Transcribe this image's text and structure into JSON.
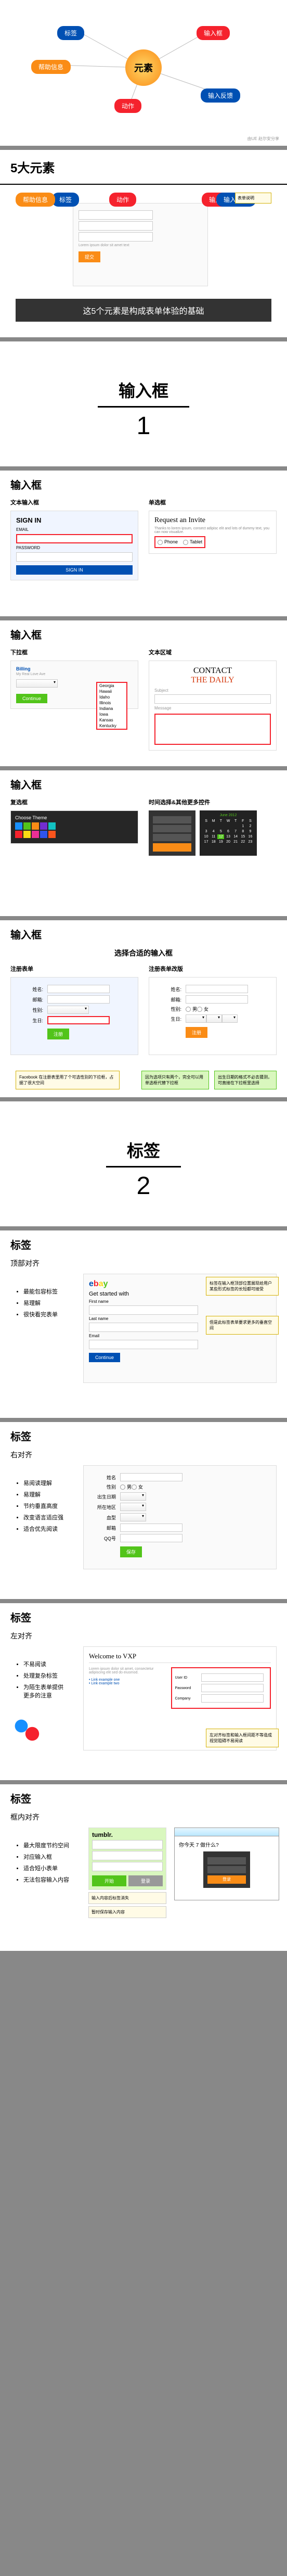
{
  "slide1": {
    "center": "元素",
    "nodes": {
      "tl": "标签",
      "tr": "输入框",
      "l": "帮助信息",
      "br": "输入反馈",
      "b": "动作"
    },
    "foot": "由UE 赵尔安分享"
  },
  "slide2": {
    "title": "5大元素",
    "banner": "这5个元素是构成表单体验的基础",
    "nodes": {
      "标签": "标签",
      "帮助信息": "帮助信息",
      "输入框": "输入框",
      "输入反馈": "输入反馈",
      "动作": "动作"
    }
  },
  "slide3": {
    "title": "输入框",
    "num": "1"
  },
  "slide4": {
    "title": "输入框",
    "left": "文本输入框",
    "right": "单选框",
    "signin": "SIGN IN",
    "req": "Request an Invite",
    "req_sub": "Thanks to lorem ipsum, consect adipisc elit and lots of dummy text, you can now visualize.",
    "radio1": "Phone",
    "radio2": "Tablet"
  },
  "slide5": {
    "title": "输入框",
    "left": "下拉框",
    "right": "文本区域",
    "billing": "Billing",
    "contact1": "CONTACT",
    "contact2": "THE DAILY",
    "subj": "Subject",
    "msg": "Message"
  },
  "slide6": {
    "title": "输入框",
    "left": "复选框",
    "right": "时间选择&其他更多控件",
    "cal": "June 2012"
  },
  "slide7": {
    "title": "输入框",
    "sub": "选择合适的输入框",
    "left": "注册表单",
    "right": "注册表单改版",
    "note1": "Facebook 在注册表里用了个可选性别的下拉框，占据了很大空间",
    "note2": "因为选项只有两个，完全可以用单选框代替下拉框",
    "note3": "出生日期的格式不必去猜测，可直接在下拉框里选择"
  },
  "slide8": {
    "title": "标签",
    "num": "2"
  },
  "slide9": {
    "title": "标签",
    "sub": "顶部对齐",
    "items": [
      "最能包容标签",
      "易理解",
      "很快看完表单"
    ],
    "ebay_label": "Get started with"
  },
  "slide10": {
    "title": "标签",
    "sub": "右对齐",
    "items": [
      "易阅读理解",
      "易理解",
      "节约垂直高度",
      "改变语言适应强",
      "适合优先阅读"
    ],
    "lbl_name": "姓名",
    "lbl_gender": "性别",
    "lbl_birth": "出生日期",
    "lbl_area": "所在地区",
    "lbl_blood": "血型",
    "lbl_email": "邮箱",
    "lbl_qq": "QQ号",
    "btn": "保存"
  },
  "slide11": {
    "title": "标签",
    "sub": "左对齐",
    "items": [
      "不易阅读",
      "处理复杂标签",
      "为陌生表单提供更多的注意"
    ],
    "welcome": "Welcome to VXP"
  },
  "slide12": {
    "title": "标签",
    "sub": "框内对齐",
    "items": [
      "最大限度节约空间",
      "对应输入框",
      "适合短小表单",
      "无法包容输入内容"
    ],
    "tumblr": "tumblr.",
    "btn_start": "开始",
    "btn_login": "登录",
    "todo": "你今天 7 做什么?",
    "btn_dark": "登录"
  }
}
